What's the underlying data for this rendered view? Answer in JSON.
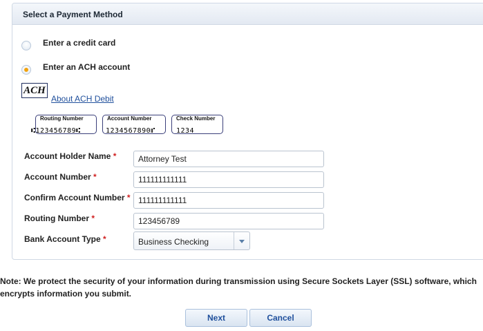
{
  "panel": {
    "title": "Select a Payment Method"
  },
  "payment_options": [
    {
      "label": "Enter a credit card",
      "selected": false
    },
    {
      "label": "Enter an ACH account",
      "selected": true
    }
  ],
  "ach": {
    "logo_text": "ACH",
    "link_text": "About ACH Debit",
    "check_captions": {
      "routing": "Routing Number",
      "account": "Account Number",
      "check": "Check Number"
    },
    "micr": {
      "routing": "⑆123456789⑆",
      "account": "1234567890⑈",
      "check": "1234"
    }
  },
  "form": {
    "required_mark": "*",
    "fields": [
      {
        "label": "Account Holder Name",
        "value": "Attorney Test"
      },
      {
        "label": "Account Number",
        "value": "111111111111"
      },
      {
        "label": "Confirm Account Number",
        "value": "111111111111"
      },
      {
        "label": "Routing Number",
        "value": "123456789"
      }
    ],
    "bank_account_type": {
      "label": "Bank Account Type",
      "value": "Business Checking"
    }
  },
  "note": "Note: We protect the security of your information during transmission using Secure Sockets Layer (SSL) software, which encrypts information you submit.",
  "buttons": {
    "next": "Next",
    "cancel": "Cancel"
  },
  "colors": {
    "accent": "#1f4f9c",
    "required": "#d02020",
    "radio_selected": "#f2a20d"
  }
}
